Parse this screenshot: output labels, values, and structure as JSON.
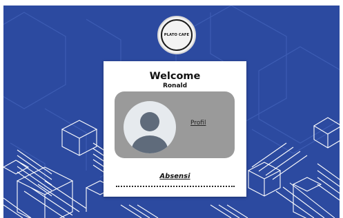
{
  "logo": {
    "text": "PLATO CAFE"
  },
  "card": {
    "welcome": "Welcome",
    "username": "Ronald",
    "profil_link": "Profil",
    "absensi_link": "Absensi"
  },
  "colors": {
    "background": "#2c4aa0",
    "card": "#ffffff",
    "profile_box": "#9a9a9a",
    "avatar_silhouette": "#5f6b7b",
    "avatar_bg": "#e6eaee"
  },
  "icons": [
    "user-avatar-icon"
  ]
}
